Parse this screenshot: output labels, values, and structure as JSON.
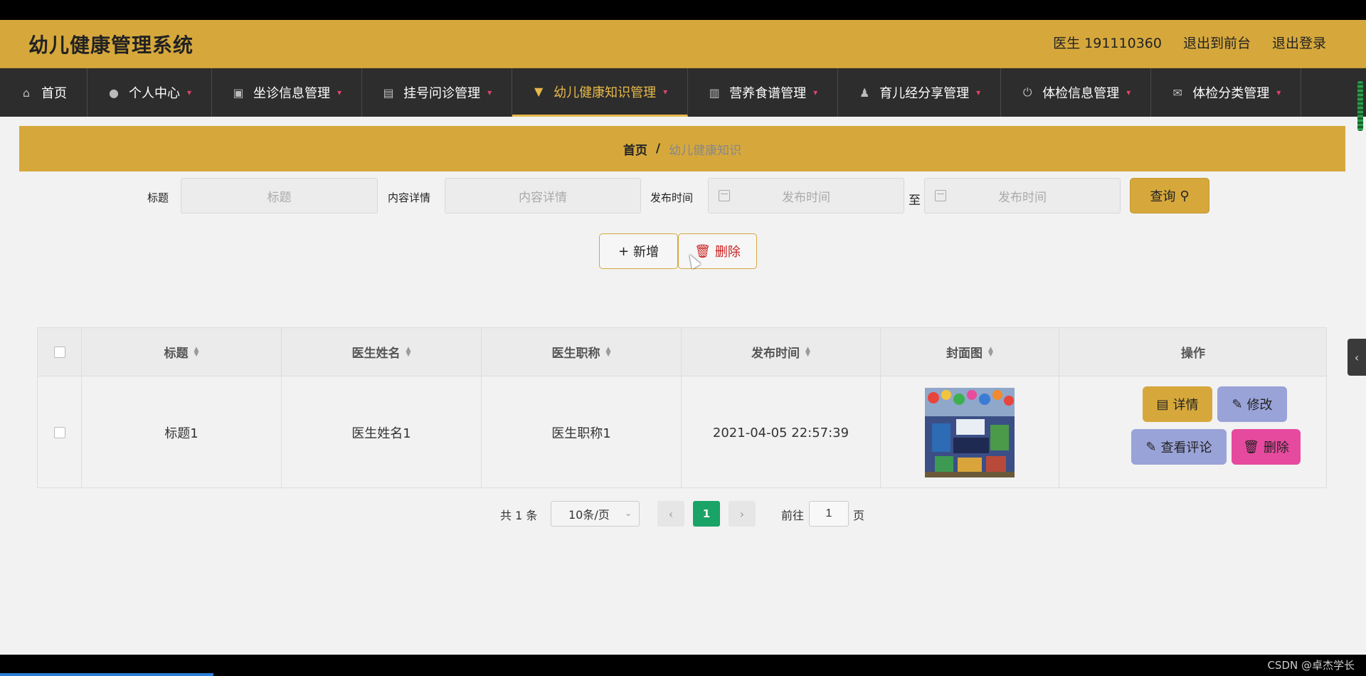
{
  "app": {
    "title": "幼儿健康管理系统",
    "user_label": "医生 191110360",
    "exit_front": "退出到前台",
    "logout": "退出登录"
  },
  "nav": [
    {
      "label": "首页",
      "icon": "home-icon",
      "dropdown": false
    },
    {
      "label": "个人中心",
      "icon": "user-icon",
      "dropdown": true
    },
    {
      "label": "坐诊信息管理",
      "icon": "chart-icon",
      "dropdown": true
    },
    {
      "label": "挂号问诊管理",
      "icon": "briefcase-icon",
      "dropdown": true
    },
    {
      "label": "幼儿健康知识管理",
      "icon": "brush-icon",
      "dropdown": true,
      "active": true
    },
    {
      "label": "营养食谱管理",
      "icon": "book-icon",
      "dropdown": true
    },
    {
      "label": "育儿经分享管理",
      "icon": "person-icon",
      "dropdown": true
    },
    {
      "label": "体检信息管理",
      "icon": "power-icon",
      "dropdown": true
    },
    {
      "label": "体检分类管理",
      "icon": "mail-icon",
      "dropdown": true
    }
  ],
  "breadcrumb": {
    "home": "首页",
    "separator": "/",
    "current": "幼儿健康知识"
  },
  "search": {
    "title_label": "标题",
    "title_placeholder": "标题",
    "content_label": "内容详情",
    "content_placeholder": "内容详情",
    "time_label": "发布时间",
    "time_start_placeholder": "发布时间",
    "time_to": "至",
    "time_end_placeholder": "发布时间",
    "query_button": "查询"
  },
  "actions": {
    "add": "新增",
    "delete": "删除"
  },
  "table": {
    "headers": [
      "标题",
      "医生姓名",
      "医生职称",
      "发布时间",
      "封面图",
      "操作"
    ],
    "rows": [
      {
        "title": "标题1",
        "doctor_name": "医生姓名1",
        "doctor_title": "医生职称1",
        "publish_time": "2021-04-05 22:57:39"
      }
    ],
    "row_actions": {
      "detail": "详情",
      "edit": "修改",
      "comment": "查看评论",
      "delete": "删除"
    }
  },
  "pagination": {
    "total": "共 1 条",
    "page_size": "10条/页",
    "current_page": "1",
    "goto_label": "前往",
    "goto_value": "1",
    "page_suffix": "页"
  },
  "watermark": "CSDN @卓杰学长",
  "colors": {
    "accent": "#d6a83c",
    "nav_bg": "#2d2d2d",
    "active_nav": "#e7b94a",
    "page_active": "#1aa366",
    "delete_pink": "#e64a9e",
    "edit_purple": "#9aa3d8"
  }
}
